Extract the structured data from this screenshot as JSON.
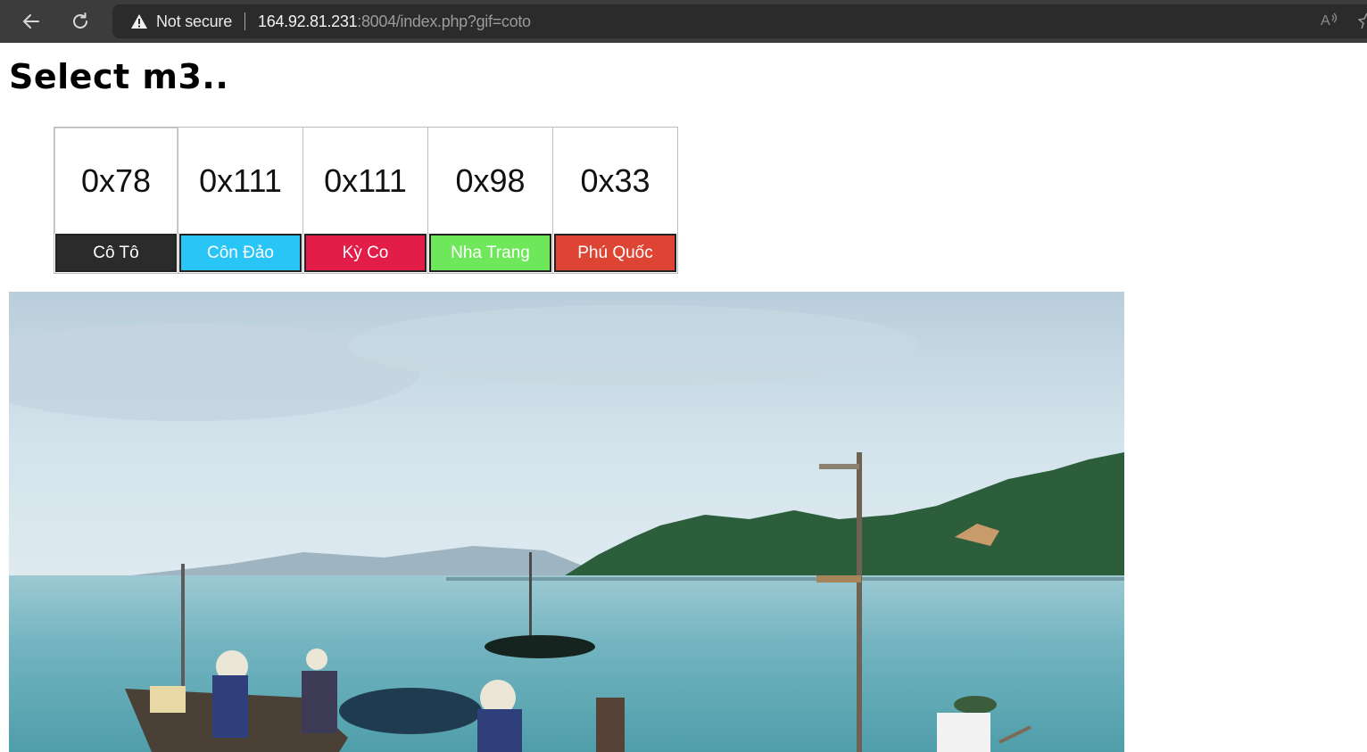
{
  "browser": {
    "security_label": "Not secure",
    "url_host": "164.92.81.231",
    "url_rest": ":8004/index.php?gif=coto",
    "read_aloud_label": "A⁾"
  },
  "page": {
    "title": "Select m3..",
    "cards": [
      {
        "value": "0x78",
        "label": "Cô Tô",
        "color": "#2b2b2b"
      },
      {
        "value": "0x111",
        "label": "Côn Đảo",
        "color": "#29c5f6"
      },
      {
        "value": "0x111",
        "label": "Kỳ Co",
        "color": "#e11d48"
      },
      {
        "value": "0x98",
        "label": "Nha Trang",
        "color": "#6ee75a"
      },
      {
        "value": "0x33",
        "label": "Phú Quốc",
        "color": "#dd4433"
      }
    ]
  },
  "colors": {
    "chrome_bg": "#3c3c3c",
    "address_bg": "#2b2b2b",
    "sky": "#c9dbe6",
    "sea": "#6fb2bf",
    "island": "#2c5e3a"
  },
  "icons": {
    "back": "back-arrow-icon",
    "reload": "reload-icon",
    "warning": "warning-triangle-icon",
    "favorite": "star-icon"
  }
}
